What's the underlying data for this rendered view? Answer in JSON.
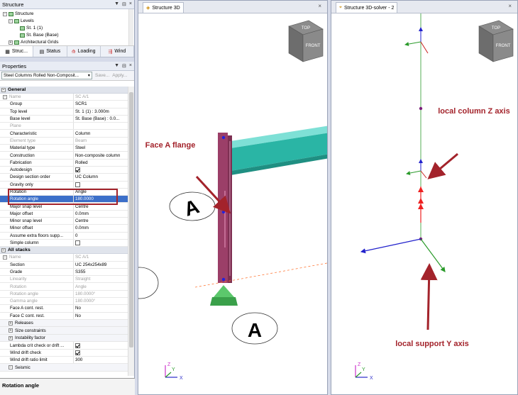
{
  "structure_panel": {
    "title": "Structure",
    "controls": [
      "▼",
      "⊟",
      "×"
    ],
    "tree": [
      "Structure",
      "Levels",
      "St. 1 (1)",
      "St. Base (Base)",
      "Architectural Grids"
    ],
    "tabs": [
      "Struc...",
      "Status",
      "Loading",
      "Wind"
    ]
  },
  "properties_panel": {
    "title": "Properties",
    "selector": "Steel Columns Rolled Non-Composit...",
    "save_label": "Save...",
    "apply_label": "Apply...",
    "general_label": "General",
    "general_rows": [
      {
        "k": "Name",
        "v": "SC A/1",
        "dim": true,
        "plus": true
      },
      {
        "k": "Group",
        "v": "SCR1"
      },
      {
        "k": "Top level",
        "v": "St. 1 (1) : 3.000m"
      },
      {
        "k": "Base level",
        "v": "St. Base (Base) : 0.0..."
      },
      {
        "k": "Plane",
        "v": "",
        "dim": true
      },
      {
        "k": "Characteristic",
        "v": "Column"
      },
      {
        "k": "Element type",
        "v": "Beam",
        "dim": true
      },
      {
        "k": "Material type",
        "v": "Steel"
      },
      {
        "k": "Construction",
        "v": "Non-composite column"
      },
      {
        "k": "Fabrication",
        "v": "Rolled"
      },
      {
        "k": "Autodesign",
        "cb": true
      },
      {
        "k": "Design section order",
        "v": "UC Column"
      },
      {
        "k": "Gravity only",
        "cb": false
      },
      {
        "k": "Rotation",
        "v": "Angle"
      },
      {
        "k": "Rotation angle",
        "v": "180.0000",
        "sel": true
      },
      {
        "k": "Major snap level",
        "v": "Centre"
      },
      {
        "k": "Major offset",
        "v": "0.0mm"
      },
      {
        "k": "Minor snap level",
        "v": "Centre"
      },
      {
        "k": "Minor offset",
        "v": "0.0mm"
      },
      {
        "k": "Assume extra floors supp...",
        "v": "0"
      },
      {
        "k": "Simple column",
        "cb": false
      }
    ],
    "stacks_label": "All stacks",
    "stack_rows": [
      {
        "k": "Name",
        "v": "SC A/1",
        "dim": true,
        "plus": true
      },
      {
        "k": "Section",
        "v": "UC 254x254x89"
      },
      {
        "k": "Grade",
        "v": "S355"
      },
      {
        "k": "Linearity",
        "v": "Straight",
        "dim": true
      },
      {
        "k": "Rotation",
        "v": "Angle",
        "dim": true
      },
      {
        "k": "Rotation angle",
        "v": "180.0000°",
        "dim": true
      },
      {
        "k": "Gamma angle",
        "v": "180.0000°",
        "dim": true
      },
      {
        "k": "Face A cont. rest.",
        "v": "No"
      },
      {
        "k": "Face C cont. rest.",
        "v": "No"
      }
    ],
    "subgroups": [
      "Releases",
      "Size constraints",
      "Instability factor"
    ],
    "tail_rows": [
      {
        "k": "Lambda crit check or drift ...",
        "cb": true
      },
      {
        "k": "Wind drift check",
        "cb": true
      },
      {
        "k": "Wind drift ratio limit",
        "v": "300"
      }
    ],
    "seismic_label": "Seismic",
    "status_text": "Rotation angle"
  },
  "view1": {
    "tab_label": "Structure 3D",
    "close": "×",
    "cube_top": "TOP",
    "cube_front": "FRONT",
    "grid_label": "A",
    "annotation": "Face A flange",
    "axis_z": "Z",
    "axis_x": "X",
    "axis_y": "Y"
  },
  "view2": {
    "tab_label": "Structure 3D-solver - 2",
    "close": "×",
    "cube_top": "TOP",
    "cube_front": "FRONT",
    "annotation_z": "local column Z axis",
    "annotation_y": "local support Y axis",
    "axis_z": "Z",
    "axis_x": "X",
    "axis_y": "Y"
  },
  "colors": {
    "annotation": "#a3232b",
    "column": "#9b3f68",
    "beam": "#2ab5a5",
    "support": "#3aa04a",
    "selection": "#3c6fc9"
  }
}
